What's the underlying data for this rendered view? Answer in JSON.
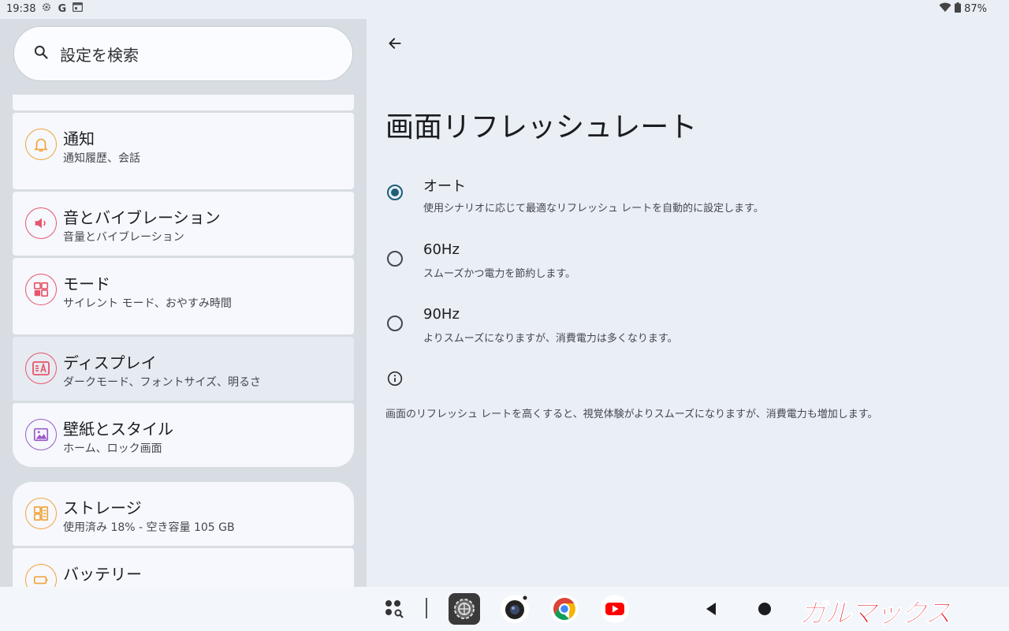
{
  "status_bar": {
    "time": "19:38",
    "battery": "87%",
    "icons": [
      "gear-icon",
      "google-icon",
      "calendar-icon",
      "wifi-icon",
      "battery-icon"
    ]
  },
  "search": {
    "placeholder": "設定を検索"
  },
  "settings_list": [
    {
      "id": "notifications",
      "title": "通知",
      "subtitle": "通知履歴、会話",
      "icon": "bell-icon",
      "color": "#f2a33a"
    },
    {
      "id": "sound",
      "title": "音とバイブレーション",
      "subtitle": "音量とバイブレーション",
      "icon": "speaker-icon",
      "color": "#e8556a"
    },
    {
      "id": "modes",
      "title": "モード",
      "subtitle": "サイレント モード、おやすみ時間",
      "icon": "modes-icon",
      "color": "#e8556a"
    },
    {
      "id": "display",
      "title": "ディスプレイ",
      "subtitle": "ダークモード、フォントサイズ、明るさ",
      "icon": "display-icon",
      "color": "#e8556a"
    },
    {
      "id": "wallpaper",
      "title": "壁紙とスタイル",
      "subtitle": "ホーム、ロック画面",
      "icon": "image-icon",
      "color": "#9b59c7"
    },
    {
      "id": "storage",
      "title": "ストレージ",
      "subtitle": "使用済み 18% - 空き容量 105 GB",
      "icon": "storage-icon",
      "color": "#f2a33a"
    },
    {
      "id": "battery",
      "title": "バッテリー",
      "subtitle": "",
      "icon": "battery-icon",
      "color": "#f2a33a"
    }
  ],
  "detail": {
    "title": "画面リフレッシュレート",
    "options": [
      {
        "label": "オート",
        "description": "使用シナリオに応じて最適なリフレッシュ レートを自動的に設定します。",
        "selected": true
      },
      {
        "label": "60Hz",
        "description": "スムーズかつ電力を節約します。",
        "selected": false
      },
      {
        "label": "90Hz",
        "description": "よりスムーズになりますが、消費電力は多くなります。",
        "selected": false
      }
    ],
    "footer": "画面のリフレッシュ レートを高くすると、視覚体験がよりスムーズになりますが、消費電力も増加します。"
  },
  "taskbar": {
    "apps": [
      "app-drawer-icon",
      "settings-app-icon",
      "camera-app-icon",
      "chrome-app-icon",
      "youtube-app-icon"
    ],
    "nav": [
      "back-icon",
      "home-icon"
    ]
  },
  "watermark": "ガルマックス"
}
